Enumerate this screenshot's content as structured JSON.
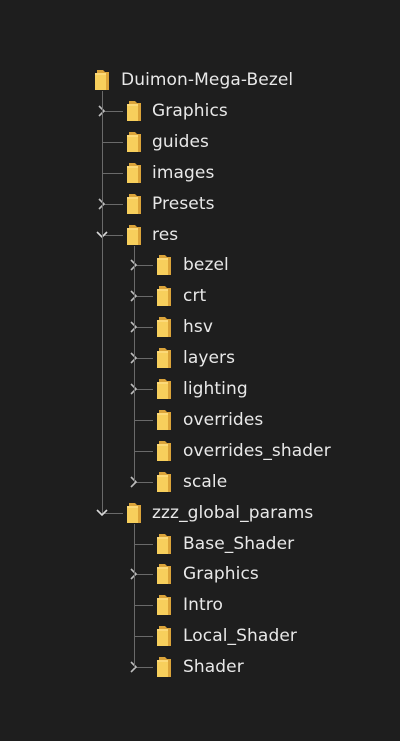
{
  "tree": {
    "root": {
      "label": "Duimon-Mega-Bezel",
      "icon": "folder-icon"
    },
    "children": [
      {
        "label": "Graphics",
        "icon": "folder-icon",
        "expander": "collapsed"
      },
      {
        "label": "guides",
        "icon": "folder-icon",
        "expander": "none"
      },
      {
        "label": "images",
        "icon": "folder-icon",
        "expander": "none"
      },
      {
        "label": "Presets",
        "icon": "folder-icon",
        "expander": "collapsed"
      },
      {
        "label": "res",
        "icon": "folder-icon",
        "expander": "expanded",
        "children": [
          {
            "label": "bezel",
            "icon": "folder-icon",
            "expander": "collapsed"
          },
          {
            "label": "crt",
            "icon": "folder-icon",
            "expander": "collapsed"
          },
          {
            "label": "hsv",
            "icon": "folder-icon",
            "expander": "collapsed"
          },
          {
            "label": "layers",
            "icon": "folder-icon",
            "expander": "collapsed"
          },
          {
            "label": "lighting",
            "icon": "folder-icon",
            "expander": "collapsed"
          },
          {
            "label": "overrides",
            "icon": "folder-icon",
            "expander": "none"
          },
          {
            "label": "overrides_shader",
            "icon": "folder-icon",
            "expander": "none"
          },
          {
            "label": "scale",
            "icon": "folder-icon",
            "expander": "collapsed"
          }
        ]
      },
      {
        "label": "zzz_global_params",
        "icon": "folder-icon",
        "expander": "expanded",
        "children": [
          {
            "label": "Base_Shader",
            "icon": "folder-icon",
            "expander": "none"
          },
          {
            "label": "Graphics",
            "icon": "folder-icon",
            "expander": "collapsed"
          },
          {
            "label": "Intro",
            "icon": "folder-icon",
            "expander": "none"
          },
          {
            "label": "Local_Shader",
            "icon": "folder-icon",
            "expander": "none"
          },
          {
            "label": "Shader",
            "icon": "folder-icon",
            "expander": "collapsed"
          }
        ]
      }
    ]
  },
  "colors": {
    "background": "#1e1e1e",
    "text": "#e8e8e8",
    "guide": "#6a6a6a",
    "folder_front": "#f7cf5c",
    "folder_back": "#dba43a"
  }
}
